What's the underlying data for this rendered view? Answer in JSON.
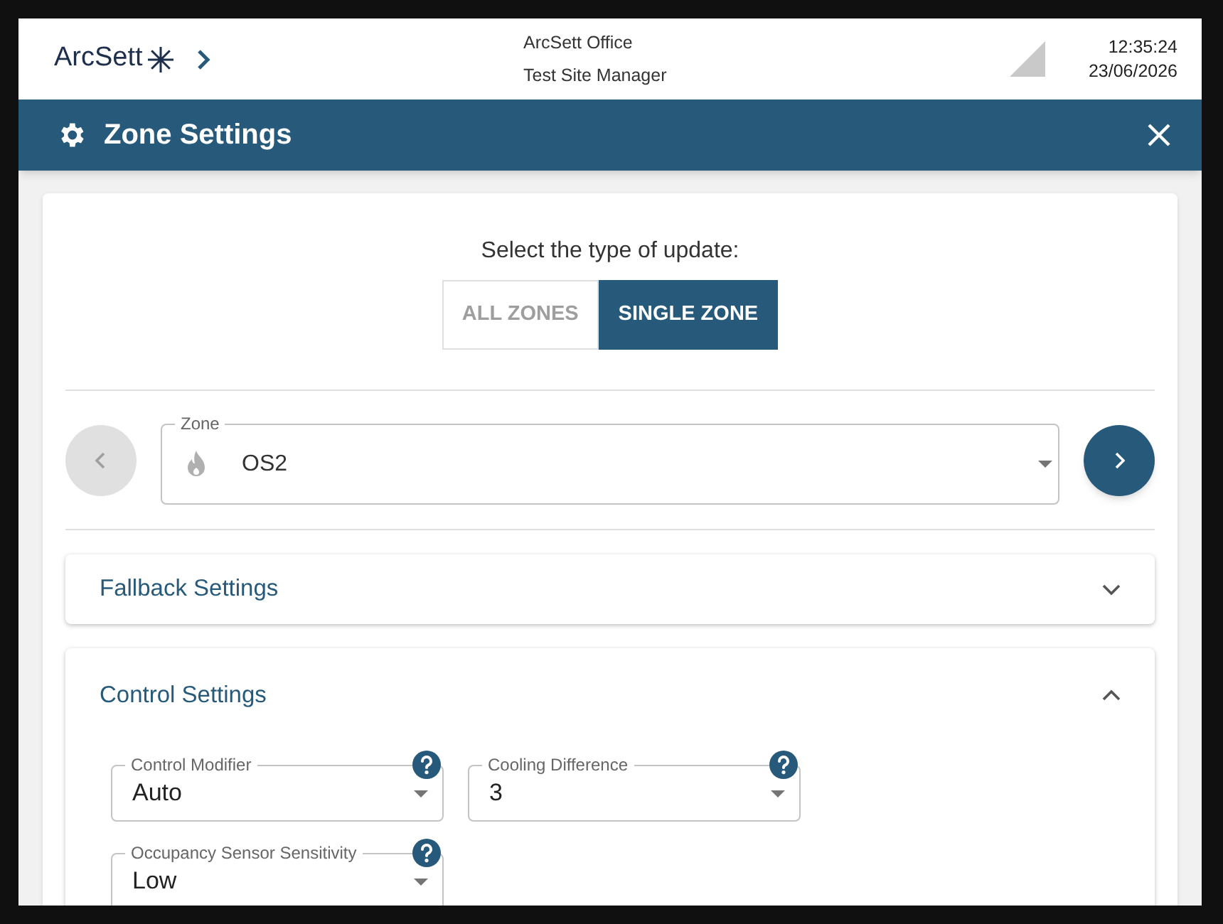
{
  "header": {
    "logo": "ArcSett",
    "site": "ArcSett Office",
    "role": "Test Site Manager",
    "time": "12:35:24",
    "date": "23/06/2026"
  },
  "title_bar": {
    "title": "Zone Settings"
  },
  "update_type": {
    "prompt": "Select the type of update:",
    "options": [
      {
        "label": "ALL ZONES",
        "selected": false
      },
      {
        "label": "SINGLE ZONE",
        "selected": true
      }
    ]
  },
  "zone_picker": {
    "label": "Zone",
    "value": "OS2",
    "prev_disabled": true,
    "next_disabled": false
  },
  "sections": [
    {
      "title": "Fallback Settings",
      "expanded": false
    },
    {
      "title": "Control Settings",
      "expanded": true,
      "fields": [
        {
          "label": "Control Modifier",
          "value": "Auto"
        },
        {
          "label": "Cooling Difference",
          "value": "3"
        },
        {
          "label": "Occupancy Sensor Sensitivity",
          "value": "Low"
        }
      ]
    }
  ]
}
